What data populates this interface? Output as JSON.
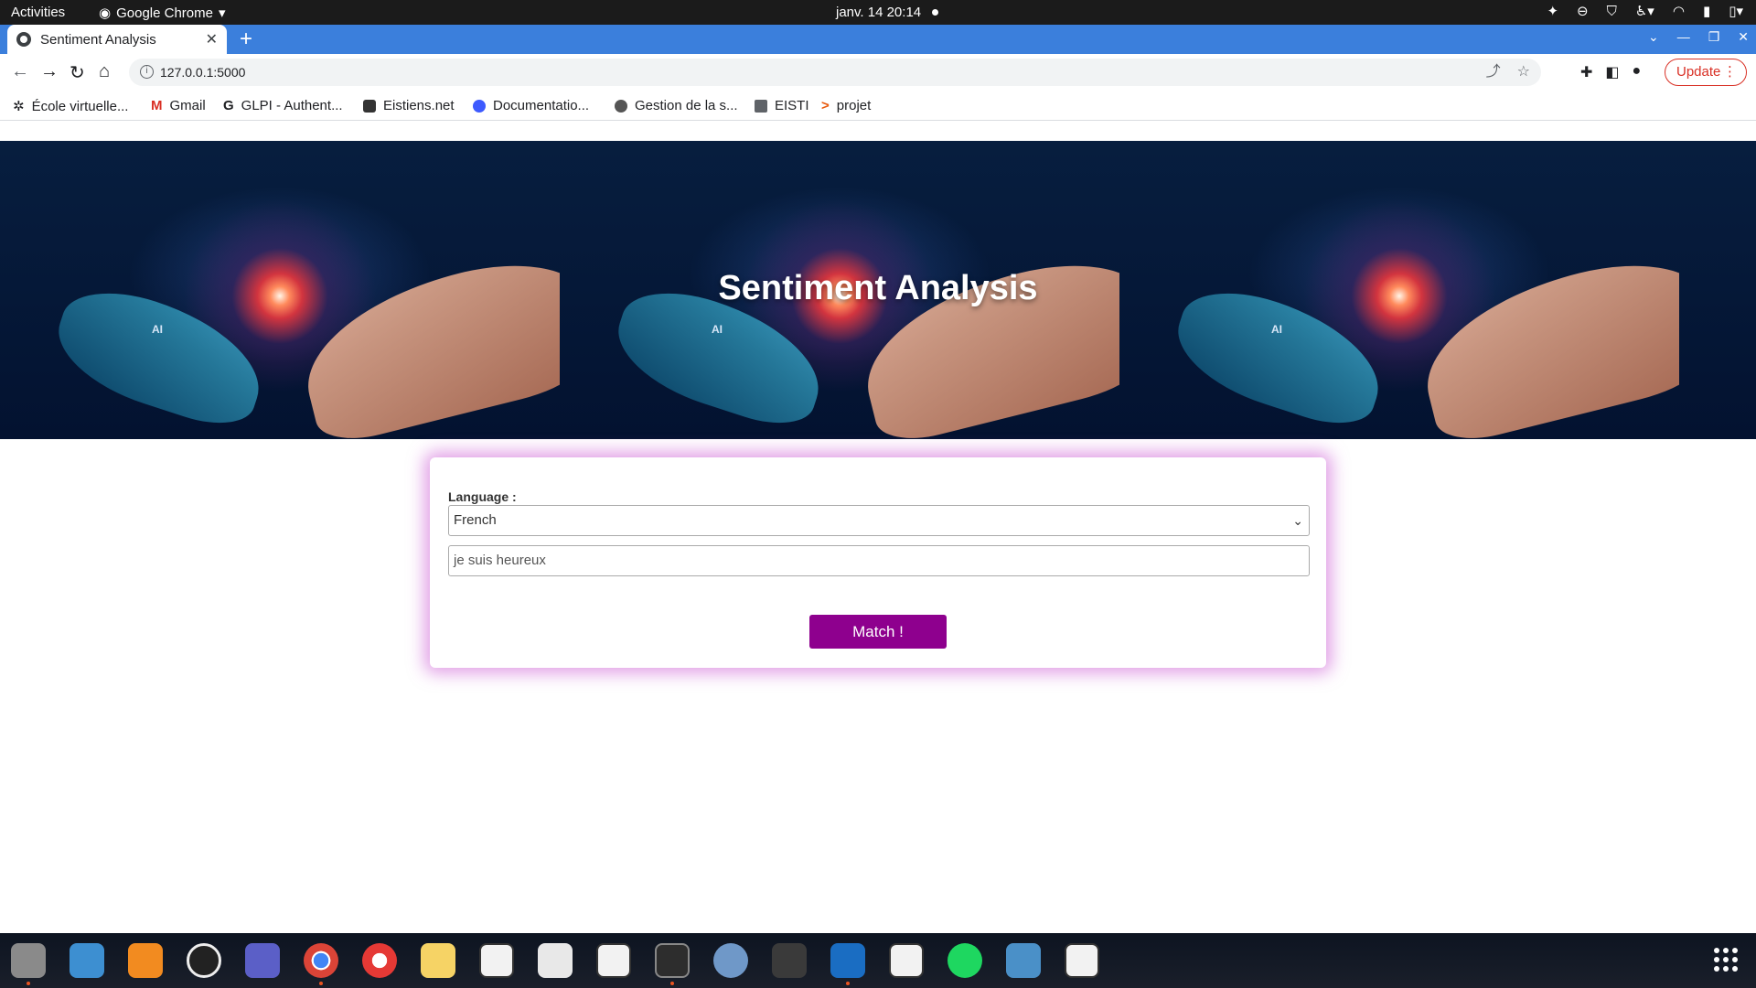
{
  "topbar": {
    "activities": "Activities",
    "app_name": "Google Chrome",
    "clock": "janv. 14  20:14"
  },
  "browser": {
    "tab_title": "Sentiment Analysis",
    "url": "127.0.0.1:5000",
    "update_label": "Update",
    "bookmarks": [
      {
        "label": "École virtuelle...",
        "icon": "gear-icon"
      },
      {
        "label": "Gmail",
        "icon": "gmail-icon"
      },
      {
        "label": "GLPI - Authent...",
        "icon": "glpi-icon"
      },
      {
        "label": "Eistiens.net",
        "icon": "site-icon"
      },
      {
        "label": "Documentatio...",
        "icon": "docs-icon"
      },
      {
        "label": "Gestion de la s...",
        "icon": "globe-icon"
      },
      {
        "label": "EISTI",
        "icon": "folder-icon"
      },
      {
        "label": "projet",
        "icon": "arrow-icon"
      }
    ]
  },
  "page": {
    "hero_title": "Sentiment Analysis",
    "hero_badge": "AI",
    "form": {
      "language_label": "Language :",
      "language_value": "French",
      "text_value": "je suis heureux",
      "submit_label": "Match !"
    }
  },
  "colors": {
    "accent": "#8e008e",
    "tab_strip": "#3b7fdc",
    "glow": "#c850d2",
    "update_red": "#d93025"
  }
}
